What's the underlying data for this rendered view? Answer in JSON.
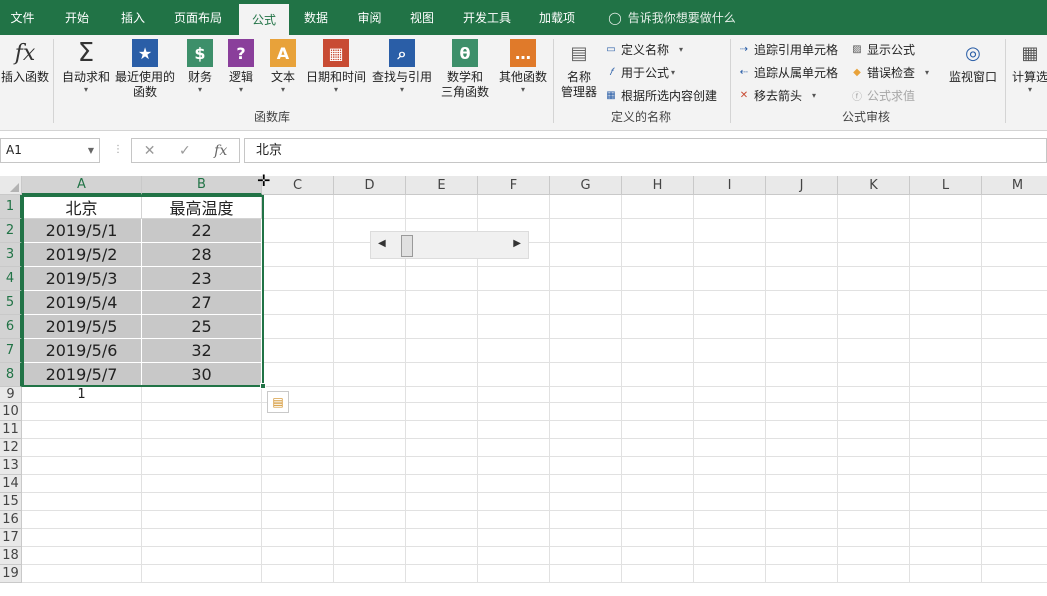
{
  "tabs": [
    {
      "label": "文件"
    },
    {
      "label": "开始"
    },
    {
      "label": "插入"
    },
    {
      "label": "页面布局"
    },
    {
      "label": "公式",
      "active": true
    },
    {
      "label": "数据"
    },
    {
      "label": "审阅"
    },
    {
      "label": "视图"
    },
    {
      "label": "开发工具"
    },
    {
      "label": "加载项"
    }
  ],
  "tell_me": "告诉我你想要做什么",
  "ribbon": {
    "insert_function": "插入函数",
    "autosum": "自动求和",
    "recent_1": "最近使用的",
    "recent_2": "函数",
    "financial": "财务",
    "logical": "逻辑",
    "text": "文本",
    "datetime": "日期和时间",
    "lookup": "查找与引用",
    "math_1": "数学和",
    "math_2": "三角函数",
    "more": "其他函数",
    "group_library": "函数库",
    "name_mgr_1": "名称",
    "name_mgr_2": "管理器",
    "define_name": "定义名称",
    "use_in_formula": "用于公式",
    "create_from_sel": "根据所选内容创建",
    "group_names": "定义的名称",
    "trace_precedents": "追踪引用单元格",
    "trace_dependents": "追踪从属单元格",
    "remove_arrows": "移去箭头",
    "show_formulas": "显示公式",
    "error_checking": "错误检查",
    "evaluate_formula": "公式求值",
    "group_audit": "公式审核",
    "watch_window": "监视窗口",
    "calc_options": "计算选"
  },
  "formula_bar": {
    "name_box": "A1",
    "content": "北京"
  },
  "columns": [
    "A",
    "B",
    "C",
    "D",
    "E",
    "F",
    "G",
    "H",
    "I",
    "J",
    "K",
    "L",
    "M"
  ],
  "rows": [
    "1",
    "2",
    "3",
    "4",
    "5",
    "6",
    "7",
    "8",
    "9",
    "10",
    "11",
    "12",
    "13",
    "14",
    "15",
    "16",
    "17",
    "18",
    "19"
  ],
  "table": {
    "headers": [
      "北京",
      "最高温度"
    ],
    "rows": [
      [
        "2019/5/1",
        "22"
      ],
      [
        "2019/5/2",
        "28"
      ],
      [
        "2019/5/3",
        "23"
      ],
      [
        "2019/5/4",
        "27"
      ],
      [
        "2019/5/5",
        "25"
      ],
      [
        "2019/5/6",
        "32"
      ],
      [
        "2019/5/7",
        "30"
      ]
    ],
    "a9": "1"
  },
  "scrollbar": {
    "value": 1
  },
  "colors": {
    "accent": "#217346",
    "selection": "#c8c8c8"
  }
}
